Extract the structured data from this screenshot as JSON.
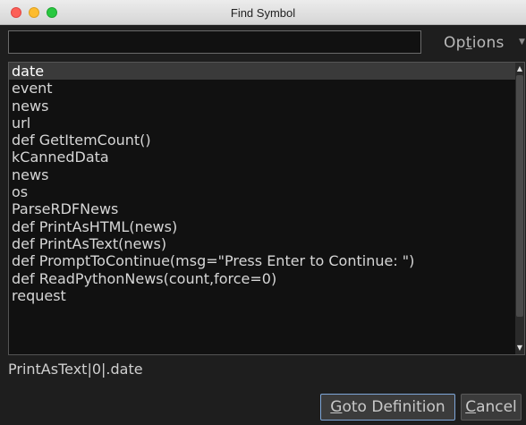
{
  "window": {
    "title": "Find Symbol"
  },
  "search": {
    "value": "",
    "placeholder": ""
  },
  "options": {
    "mnemonic_prefix": "Op",
    "mnemonic_letter": "t",
    "mnemonic_suffix": "ions"
  },
  "symbols": {
    "items": [
      "date",
      "event",
      "news",
      "url",
      "def GetItemCount()",
      "kCannedData",
      "news",
      "os",
      "ParseRDFNews",
      "def PrintAsHTML(news)",
      "def PrintAsText(news)",
      "def PromptToContinue(msg=\"Press Enter to Continue: \")",
      "def ReadPythonNews(count,force=0)",
      "request"
    ],
    "selected_index": 0
  },
  "status": {
    "path": "PrintAsText|0|.date"
  },
  "buttons": {
    "goto_letter": "G",
    "goto_rest": "oto Definition",
    "cancel_letter": "C",
    "cancel_rest": "ancel"
  },
  "icons": {
    "scroll_up": "scroll-up-arrow",
    "scroll_down": "scroll-down-arrow",
    "options_menu": "chevron-down"
  },
  "colors": {
    "background": "#1e1e1e",
    "list_background": "#111111",
    "selected_row": "#3a3a3a",
    "focus_border": "#7ea6d8",
    "close": "#fc5f57",
    "minimize": "#fdbc2e",
    "maximize": "#28c840"
  }
}
